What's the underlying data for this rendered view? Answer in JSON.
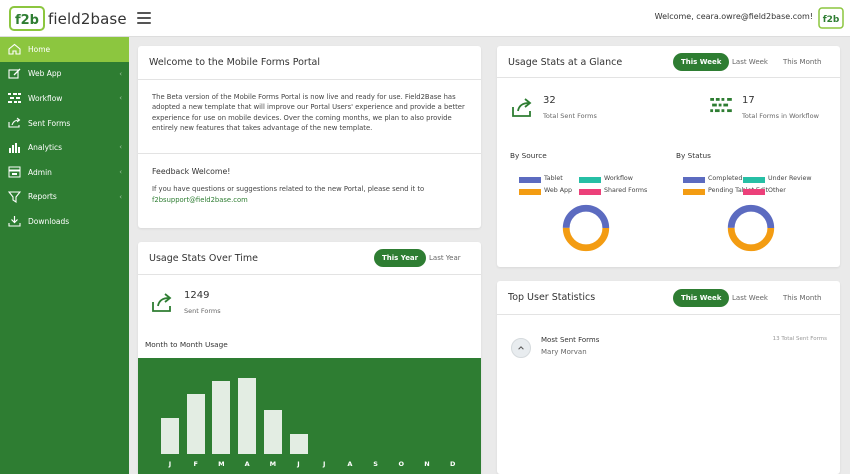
{
  "header": {
    "logo_text": "field2base",
    "welcome": "Welcome, ceara.owre@field2base.com!"
  },
  "sidebar": {
    "items": [
      {
        "label": "Home",
        "icon": "home-icon",
        "active": true,
        "chevron": false
      },
      {
        "label": "Web App",
        "icon": "edit-icon",
        "active": false,
        "chevron": true
      },
      {
        "label": "Workflow",
        "icon": "workflow-icon",
        "active": false,
        "chevron": true
      },
      {
        "label": "Sent Forms",
        "icon": "share-icon",
        "active": false,
        "chevron": false
      },
      {
        "label": "Analytics",
        "icon": "bar-chart-icon",
        "active": false,
        "chevron": true
      },
      {
        "label": "Admin",
        "icon": "admin-icon",
        "active": false,
        "chevron": true
      },
      {
        "label": "Reports",
        "icon": "filter-icon",
        "active": false,
        "chevron": true
      },
      {
        "label": "Downloads",
        "icon": "download-icon",
        "active": false,
        "chevron": false
      }
    ]
  },
  "welcome_card": {
    "title": "Welcome to the Mobile Forms Portal",
    "body": "The Beta version of the Mobile Forms Portal is now live and ready for use. Field2Base has adopted a new template that will improve our Portal Users' experience and provide a better experience for use on mobile devices. Over the coming months, we plan to also provide entirely new features that takes advantage of the new template.",
    "feedback_title": "Feedback Welcome!",
    "feedback_body": "If you have questions or suggestions related to the new Portal, please send it to",
    "feedback_email": "f2bsupport@field2base.com"
  },
  "usage_over_time": {
    "title": "Usage Stats Over Time",
    "tabs": [
      "This Year",
      "Last Year"
    ],
    "active_tab": 0,
    "count": "1249",
    "count_label": "Sent Forms",
    "chart_title": "Month to Month Usage"
  },
  "chart_data": {
    "type": "bar",
    "title": "Month to Month Usage",
    "categories": [
      "J",
      "F",
      "M",
      "A",
      "M",
      "J",
      "J",
      "A",
      "S",
      "O",
      "N",
      "D"
    ],
    "values": [
      38,
      62,
      76,
      79,
      46,
      21,
      0,
      0,
      0,
      0,
      0,
      0
    ],
    "ylim": [
      0,
      100
    ],
    "bar_color": "#e3ede3",
    "background": "#2e7d32"
  },
  "glance": {
    "title": "Usage Stats at a Glance",
    "tabs": [
      "This Week",
      "Last Week",
      "This Month"
    ],
    "active_tab": 0,
    "sent_count": "32",
    "sent_label": "Total Sent Forms",
    "workflow_count": "17",
    "workflow_label": "Total Forms in Workflow",
    "by_source": {
      "title": "By Source",
      "legend": [
        {
          "label": "Tablet",
          "color": "#5c6bc0"
        },
        {
          "label": "Workflow",
          "color": "#26bfa5"
        },
        {
          "label": "Web App",
          "color": "#f39c12"
        },
        {
          "label": "Shared Forms",
          "color": "#ec407a"
        }
      ],
      "values": [
        50,
        0,
        50,
        0
      ]
    },
    "by_status": {
      "title": "By Status",
      "legend": [
        {
          "label": "Completed",
          "color": "#5c6bc0"
        },
        {
          "label": "Under Review",
          "color": "#26bfa5"
        },
        {
          "label": "Pending Tablet Edit",
          "color": "#f39c12"
        },
        {
          "label": "Other",
          "color": "#ec407a"
        }
      ],
      "values": [
        50,
        0,
        50,
        0
      ]
    }
  },
  "top_users": {
    "title": "Top User Statistics",
    "tabs": [
      "This Week",
      "Last Week",
      "This Month"
    ],
    "active_tab": 0,
    "row_title": "Most Sent Forms",
    "row_name": "Mary Morvan",
    "row_count": "13 Total Sent Forms"
  }
}
